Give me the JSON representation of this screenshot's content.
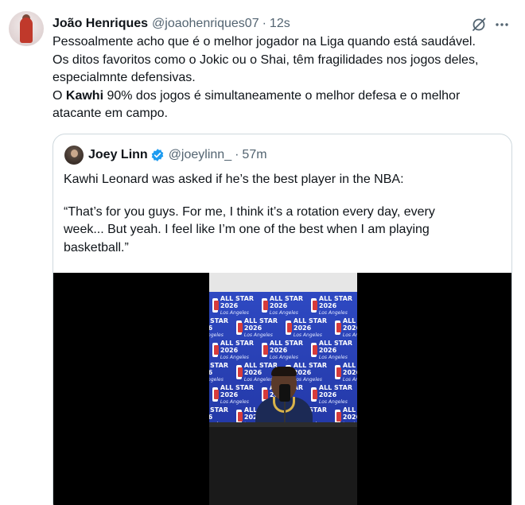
{
  "tweet": {
    "author_name": "João Henriques",
    "handle": "@joaohenriques07",
    "separator": "·",
    "time": "12s",
    "avatar_icon": "user-avatar",
    "grok_icon": "grok-icon",
    "more_icon": "more-icon",
    "lines": [
      "Pessoalmente acho que é o melhor jogador na Liga quando está saudável.",
      "Os ditos favoritos como o Jokic ou o Shai, têm fragilidades nos jogos deles,",
      "especialmnte defensivas."
    ],
    "line4_prefix": "O ",
    "line4_bold": "Kawhi",
    "line4_suffix": " 90% dos jogos é simultaneamente o melhor defesa e o melhor",
    "line5": "atacante em campo."
  },
  "quote": {
    "author_name": "Joey Linn",
    "verified_icon": "verified-badge-icon",
    "handle": "@joeylinn_",
    "separator": "·",
    "time": "57m",
    "line1": "Kawhi Leonard was asked if he’s the best player in the NBA:",
    "line2": "“That’s for you guys. For me, I think it’s a rotation every day, every",
    "line3": "week... But yeah. I feel like I’m one of the best when I am playing",
    "line4": "basketball.”",
    "media": {
      "type": "video",
      "backdrop_wordmark": "ALL STAR 2026",
      "backdrop_sub": "Los Angeles"
    }
  },
  "colors": {
    "text": "#0f1419",
    "secondary": "#536471",
    "border": "#cfd9de",
    "verified": "#1d9bf0",
    "backdrop": "#2e49c2"
  }
}
